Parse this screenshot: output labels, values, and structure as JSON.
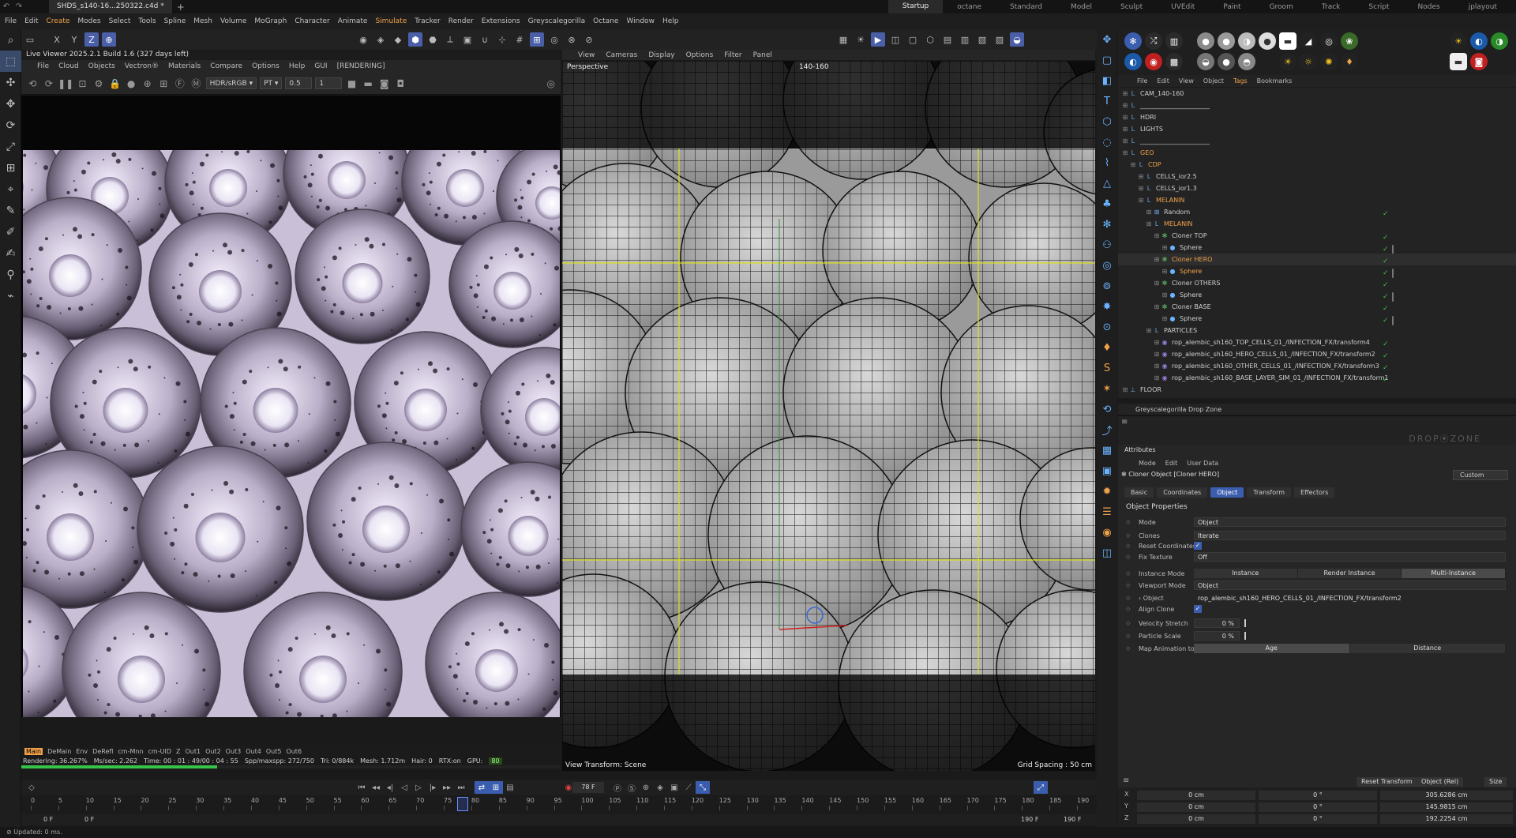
{
  "titlebar": {
    "doc_tab": "SHDS_s140-16...250322.c4d *",
    "add_tab": "+",
    "layouts": [
      "Startup",
      "octane",
      "Standard",
      "Model",
      "Sculpt",
      "UVEdit",
      "Paint",
      "Groom",
      "Track",
      "Script",
      "Nodes",
      "jplayout"
    ],
    "active_layout": "Startup"
  },
  "menubar": [
    "File",
    "Edit",
    "Create",
    "Modes",
    "Select",
    "Tools",
    "Spline",
    "Mesh",
    "Volume",
    "MoGraph",
    "Character",
    "Animate",
    "Simulate",
    "Tracker",
    "Render",
    "Extensions",
    "Greyscalegorilla",
    "Octane",
    "Window",
    "Help"
  ],
  "menubar_highlight": [
    "Create",
    "Simulate"
  ],
  "live_viewer": {
    "title": "Live Viewer 2025.2.1 Build 1.6 (327 days left)",
    "menu": [
      "File",
      "Cloud",
      "Objects",
      "Vectron®",
      "Materials",
      "Compare",
      "Options",
      "Help",
      "GUI",
      "[RENDERING]"
    ],
    "color_space": "HDR/sRGB",
    "kernel": "PT",
    "value_a": "0.5",
    "value_b": "1",
    "pass_tabs": [
      "Main",
      "DeMain",
      "Env",
      "DeRefl",
      "cm-Mnn",
      "cm-UID",
      "Z",
      "Out1",
      "Out2",
      "Out3",
      "Out4",
      "Out5",
      "Out6"
    ],
    "active_pass": "Main",
    "stats": {
      "rendering": "Rendering: 36.267%",
      "ms_sec": "Ms/sec: 2.262",
      "time": "Time: 00 : 01 : 49/00 : 04 : 55",
      "spp": "Spp/maxspp: 272/750",
      "tri": "Tri: 0/884k",
      "mesh": "Mesh: 1.712m",
      "hair": "Hair: 0",
      "rtx": "RTX:on",
      "gpu": "GPU:",
      "gpu_val": "80"
    },
    "progress": 0.36267
  },
  "viewport": {
    "menu": [
      "View",
      "Cameras",
      "Display",
      "Options",
      "Filter",
      "Panel"
    ],
    "label": "Perspective",
    "camera": "140-160",
    "view_transform": "View Transform: Scene",
    "grid_spacing": "Grid Spacing : 50 cm"
  },
  "object_manager": {
    "menu": [
      "File",
      "Edit",
      "View",
      "Object",
      "Tags",
      "Bookmarks"
    ],
    "menu_highlight": "Tags",
    "tree": [
      {
        "name": "CAM_140-160",
        "depth": 0,
        "color": "#cfcfcf",
        "icon": "null-icon"
      },
      {
        "name": "______________________",
        "depth": 0,
        "color": "#cfcfcf",
        "icon": "null-icon"
      },
      {
        "name": "HDRI",
        "depth": 0,
        "color": "#cfcfcf",
        "icon": "null-icon"
      },
      {
        "name": "LIGHTS",
        "depth": 0,
        "color": "#cfcfcf",
        "icon": "null-icon"
      },
      {
        "name": "______________________",
        "depth": 0,
        "color": "#cfcfcf",
        "icon": "null-icon"
      },
      {
        "name": "GEO",
        "depth": 0,
        "color": "#f0a14a",
        "icon": "null-icon"
      },
      {
        "name": "CDP",
        "depth": 1,
        "color": "#f0a14a",
        "icon": "null-icon"
      },
      {
        "name": "CELLS_ior2.5",
        "depth": 2,
        "color": "#cfcfcf",
        "icon": "null-icon"
      },
      {
        "name": "CELLS_ior1.3",
        "depth": 2,
        "color": "#cfcfcf",
        "icon": "null-icon"
      },
      {
        "name": "MELANIN",
        "depth": 2,
        "color": "#f0a14a",
        "icon": "null-icon"
      },
      {
        "name": "Random",
        "depth": 3,
        "color": "#cfcfcf",
        "icon": "effector-icon"
      },
      {
        "name": "MELANIN",
        "depth": 3,
        "color": "#f0a14a",
        "icon": "null-icon"
      },
      {
        "name": "Cloner TOP",
        "depth": 4,
        "color": "#cfcfcf",
        "icon": "cloner-icon"
      },
      {
        "name": "Sphere",
        "depth": 5,
        "color": "#cfcfcf",
        "icon": "sphere-icon"
      },
      {
        "name": "Cloner HERO",
        "depth": 4,
        "color": "#f0a14a",
        "icon": "cloner-icon"
      },
      {
        "name": "Sphere",
        "depth": 5,
        "color": "#f0a14a",
        "icon": "sphere-icon"
      },
      {
        "name": "Cloner OTHERS",
        "depth": 4,
        "color": "#cfcfcf",
        "icon": "cloner-icon"
      },
      {
        "name": "Sphere",
        "depth": 5,
        "color": "#cfcfcf",
        "icon": "sphere-icon"
      },
      {
        "name": "Cloner BASE",
        "depth": 4,
        "color": "#cfcfcf",
        "icon": "cloner-icon"
      },
      {
        "name": "Sphere",
        "depth": 5,
        "color": "#cfcfcf",
        "icon": "sphere-icon"
      },
      {
        "name": "PARTICLES",
        "depth": 3,
        "color": "#cfcfcf",
        "icon": "null-icon"
      },
      {
        "name": "rop_alembic_sh160_TOP_CELLS_01_/INFECTION_FX/transform4",
        "depth": 4,
        "color": "#cfcfcf",
        "icon": "alembic-icon"
      },
      {
        "name": "rop_alembic_sh160_HERO_CELLS_01_/INFECTION_FX/transform2",
        "depth": 4,
        "color": "#cfcfcf",
        "icon": "alembic-icon"
      },
      {
        "name": "rop_alembic_sh160_OTHER_CELLS_01_/INFECTION_FX/transform3",
        "depth": 4,
        "color": "#cfcfcf",
        "icon": "alembic-icon"
      },
      {
        "name": "rop_alembic_sh160_BASE_LAYER_SIM_01_/INFECTION_FX/transform1",
        "depth": 4,
        "color": "#cfcfcf",
        "icon": "alembic-icon"
      },
      {
        "name": "FLOOR",
        "depth": 0,
        "color": "#cfcfcf",
        "icon": "floor-icon"
      }
    ]
  },
  "drop_zone": {
    "title": "Greyscalegorilla Drop Zone",
    "logo": "DROP⦿ZONE"
  },
  "attributes": {
    "tab": "Attributes",
    "menu": [
      "Mode",
      "Edit",
      "User Data"
    ],
    "object": "Cloner Object [Cloner HERO]",
    "preset": "Custom",
    "tabs": [
      "Basic",
      "Coordinates",
      "Object",
      "Transform",
      "Effectors"
    ],
    "active_tab": "Object",
    "section": "Object Properties",
    "mode_label": "Mode",
    "mode_value": "Object",
    "clones_label": "Clones",
    "clones_value": "Iterate",
    "reset_label": "Reset Coordinates",
    "fix_label": "Fix Texture",
    "fix_value": "Off",
    "instance_label": "Instance Mode",
    "instance_options": [
      "Instance",
      "Render Instance",
      "Multi-Instance"
    ],
    "instance_active": "Multi-Instance",
    "viewport_mode_label": "Viewport Mode",
    "viewport_mode_value": "Object",
    "object_label": "Object",
    "object_value": "rop_alembic_sh160_HERO_CELLS_01_/INFECTION_FX/transform2",
    "align_label": "Align Clone",
    "velocity_label": "Velocity Stretch",
    "velocity_value": "0 %",
    "particle_label": "Particle Scale",
    "particle_value": "0 %",
    "map_label": "Map Animation to",
    "map_options": [
      "Age",
      "Distance"
    ],
    "map_active": "Age"
  },
  "coordinates": {
    "reset_button": "Reset Transform",
    "mode": "Object (Rel)",
    "size_button": "Size",
    "rows": [
      {
        "axis": "X",
        "pos": "0 cm",
        "rot": "0 °",
        "size": "305.6286 cm"
      },
      {
        "axis": "Y",
        "pos": "0 cm",
        "rot": "0 °",
        "size": "145.9815 cm"
      },
      {
        "axis": "Z",
        "pos": "0 cm",
        "rot": "0 °",
        "size": "192.2254 cm"
      }
    ]
  },
  "timeline": {
    "current_frame": "78 F",
    "ticks": [
      "0",
      "5",
      "10",
      "15",
      "20",
      "25",
      "30",
      "35",
      "40",
      "45",
      "50",
      "55",
      "60",
      "65",
      "70",
      "75",
      "80",
      "85",
      "90",
      "95",
      "100",
      "105",
      "110",
      "115",
      "120",
      "125",
      "130",
      "135",
      "140",
      "145",
      "150",
      "155",
      "160",
      "165",
      "170",
      "175",
      "180",
      "185",
      "190"
    ],
    "start_a": "0 F",
    "start_b": "0 F",
    "end_a": "190 F",
    "end_b": "190 F",
    "playhead_frame": 78,
    "max_frame": 190
  },
  "status": "Updated: 0 ms."
}
